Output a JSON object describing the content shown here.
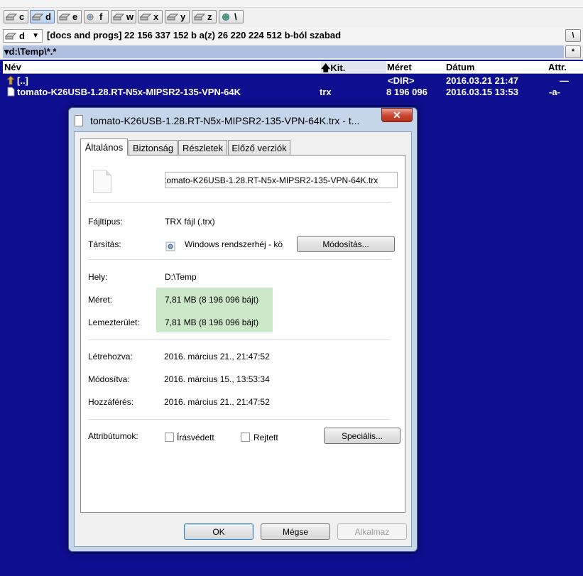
{
  "drives": [
    {
      "label": "c",
      "active": false
    },
    {
      "label": "d",
      "active": true
    },
    {
      "label": "e",
      "active": false
    },
    {
      "label": "f",
      "active": false
    },
    {
      "label": "w",
      "active": false
    },
    {
      "label": "x",
      "active": false
    },
    {
      "label": "y",
      "active": false
    },
    {
      "label": "z",
      "active": false
    },
    {
      "label": "\\",
      "active": false
    }
  ],
  "pathbar": {
    "drive": "d",
    "free_info": "[docs and progs]  22 156 337 152 b a(z) 26 220 224 512 b-ból szabad",
    "root_button": "\\",
    "star_button": "*"
  },
  "current_path": "▾d:\\Temp\\*.*",
  "columns": {
    "name": "Név",
    "ext": "Kit.",
    "size": "Méret",
    "date": "Dátum",
    "attr": "Attr."
  },
  "files": [
    {
      "name": "[..]",
      "ext": "",
      "size": "<DIR>",
      "date": "2016.03.21 21:47",
      "attr": "—"
    },
    {
      "name": "tomato-K26USB-1.28.RT-N5x-MIPSR2-135-VPN-64K",
      "ext": "trx",
      "size": "8 196 096",
      "date": "2016.03.15 13:53",
      "attr": "-a-"
    }
  ],
  "dialog": {
    "title": "tomato-K26USB-1.28.RT-N5x-MIPSR2-135-VPN-64K.trx - t...",
    "close": "✕",
    "tabs": [
      "Általános",
      "Biztonság",
      "Részletek",
      "Előző verziók"
    ],
    "filename": "tomato-K26USB-1.28.RT-N5x-MIPSR2-135-VPN-64K.trx",
    "type_label": "Fájltípus:",
    "type_value": "TRX fájl (.trx)",
    "assoc_label": "Társítás:",
    "assoc_value": "Windows rendszerhéj - kö",
    "change_button": "Módosítás...",
    "location_label": "Hely:",
    "location_value": "D:\\Temp",
    "size_label": "Méret:",
    "size_value": "7,81 MB (8 196 096 bájt)",
    "disk_label": "Lemezterület:",
    "disk_value": "7,81 MB (8 196 096 bájt)",
    "created_label": "Létrehozva:",
    "created_value": "2016. március 21., 21:47:52",
    "modified_label": "Módosítva:",
    "modified_value": "2016. március 15., 13:53:34",
    "accessed_label": "Hozzáférés:",
    "accessed_value": "2016. március 21., 21:47:52",
    "attrs_label": "Attribútumok:",
    "readonly_label": "Írásvédett",
    "hidden_label": "Rejtett",
    "special_button": "Speciális...",
    "ok": "OK",
    "cancel": "Mégse",
    "apply": "Alkalmaz"
  }
}
